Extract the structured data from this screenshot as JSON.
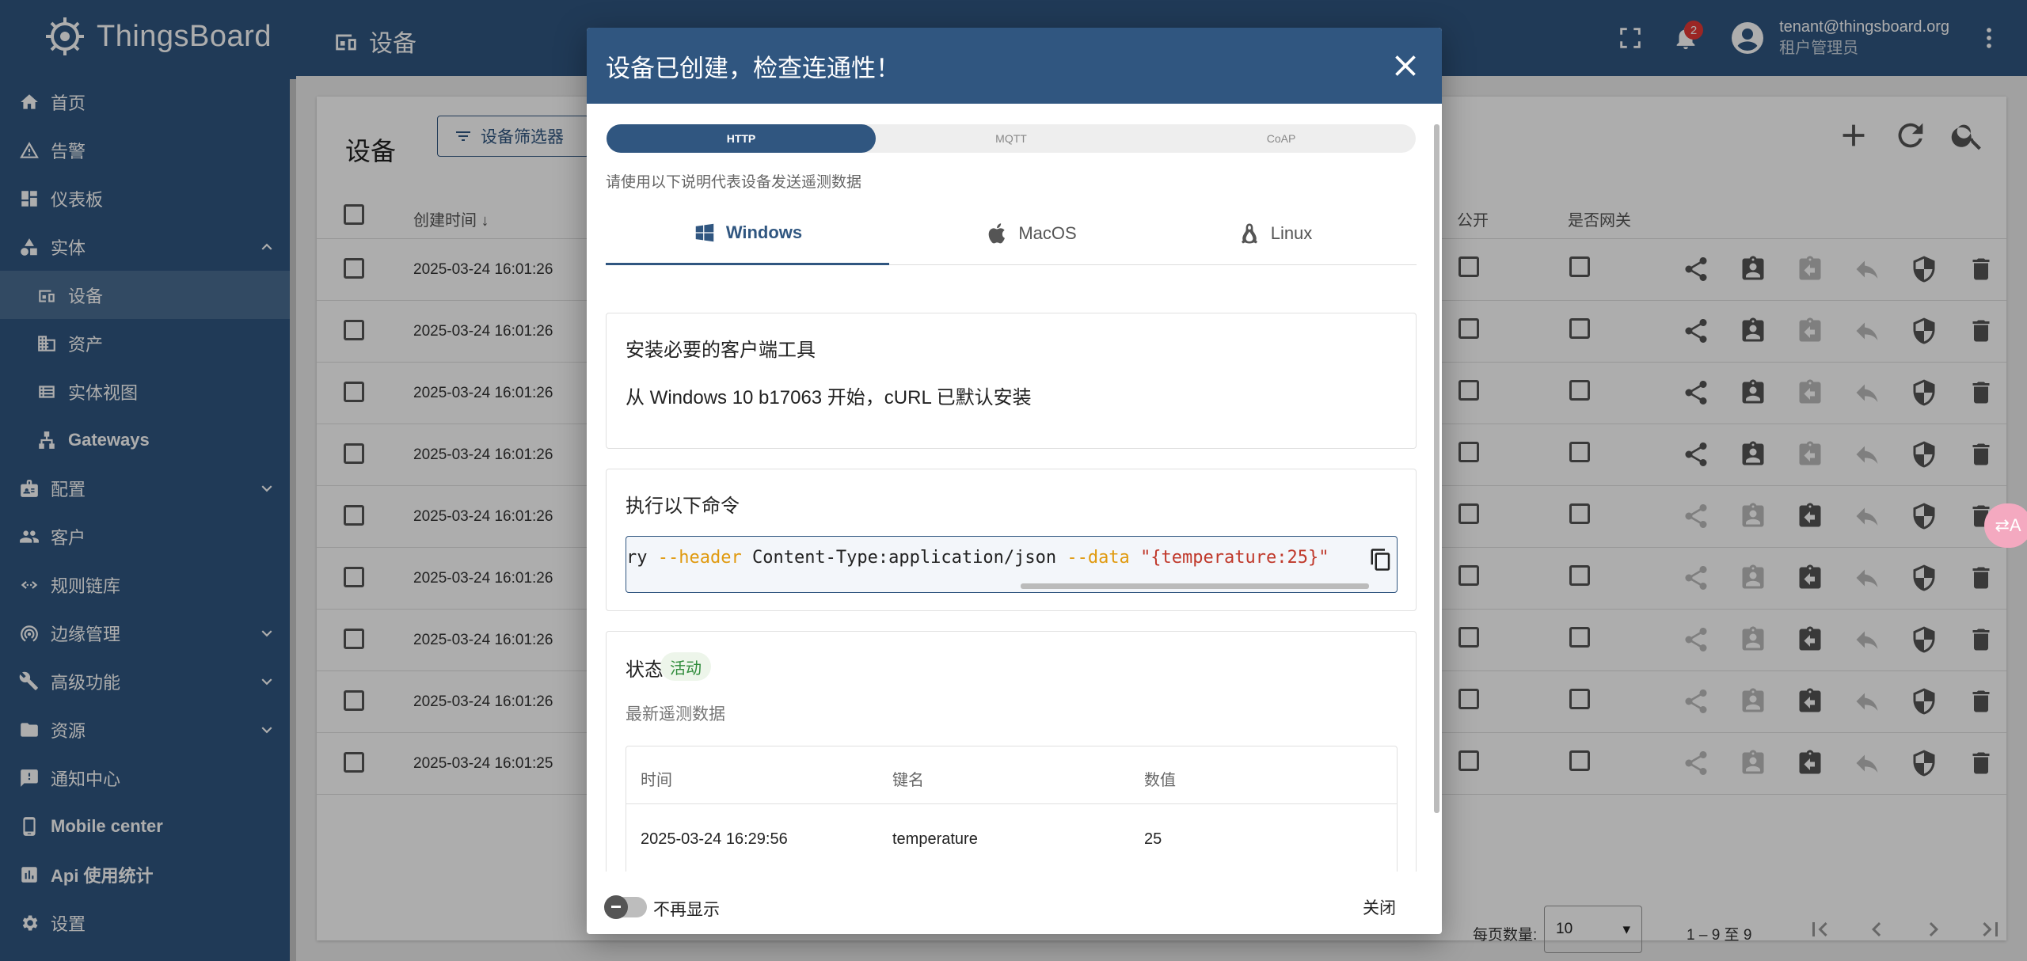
{
  "app": {
    "name": "ThingsBoard",
    "page": "设备"
  },
  "topbar": {
    "notifications_count": "2",
    "user_email": "tenant@thingsboard.org",
    "user_role": "租户管理员"
  },
  "sidebar": {
    "items": [
      {
        "label": "首页",
        "icon": "home-icon"
      },
      {
        "label": "告警",
        "icon": "warning-icon"
      },
      {
        "label": "仪表板",
        "icon": "dashboard-icon"
      },
      {
        "label": "实体",
        "icon": "entity-icon"
      },
      {
        "label": "设备",
        "icon": "device-icon"
      },
      {
        "label": "资产",
        "icon": "asset-icon"
      },
      {
        "label": "实体视图",
        "icon": "entity-view-icon"
      },
      {
        "label": "Gateways",
        "icon": "gateway-icon"
      },
      {
        "label": "配置",
        "icon": "profiles-icon"
      },
      {
        "label": "客户",
        "icon": "customers-icon"
      },
      {
        "label": "规则链库",
        "icon": "rule-chain-icon"
      },
      {
        "label": "边缘管理",
        "icon": "edge-icon"
      },
      {
        "label": "高级功能",
        "icon": "advanced-icon"
      },
      {
        "label": "资源",
        "icon": "folder-icon"
      },
      {
        "label": "通知中心",
        "icon": "notification-center-icon"
      },
      {
        "label": "Mobile center",
        "icon": "mobile-icon"
      },
      {
        "label": "Api 使用统计",
        "icon": "api-usage-icon"
      },
      {
        "label": "设置",
        "icon": "settings-icon"
      }
    ]
  },
  "devices_card": {
    "title": "设备",
    "filter_label": "设备筛选器",
    "columns": {
      "created_time": "创建时间",
      "is_public": "公开",
      "is_gateway": "是否网关"
    },
    "rows": [
      "2025-03-24 16:01:26",
      "2025-03-24 16:01:26",
      "2025-03-24 16:01:26",
      "2025-03-24 16:01:26",
      "2025-03-24 16:01:26",
      "2025-03-24 16:01:26",
      "2025-03-24 16:01:26",
      "2025-03-24 16:01:26",
      "2025-03-24 16:01:25"
    ],
    "page_size_label": "每页数量:",
    "page_size": "10",
    "range": "1 – 9 至 9"
  },
  "dialog": {
    "title": "设备已创建，检查连通性！",
    "protocols": [
      "HTTP",
      "MQTT",
      "CoAP"
    ],
    "hint": "请使用以下说明代表设备发送遥测数据",
    "os_tabs": [
      "Windows",
      "MacOS",
      "Linux"
    ],
    "install_title": "安装必要的客户端工具",
    "install_text": "从 Windows 10 b17063 开始，cURL 已默认安装",
    "command_title": "执行以下命令",
    "command": {
      "prefix": "ry ",
      "flag1": "--header",
      "middle": " Content-Type:application/json ",
      "flag2": "--data",
      "space": " ",
      "value": "\"{temperature:25}\""
    },
    "status_label": "状态",
    "status_value": "活动",
    "latest_label": "最新遥测数据",
    "telemetry": {
      "headers": [
        "时间",
        "键名",
        "数值"
      ],
      "rows": [
        [
          "2025-03-24 16:29:56",
          "temperature",
          "25"
        ]
      ]
    },
    "dont_show_label": "不再显示",
    "close_label": "关闭"
  },
  "translate_fab": "⇄A"
}
